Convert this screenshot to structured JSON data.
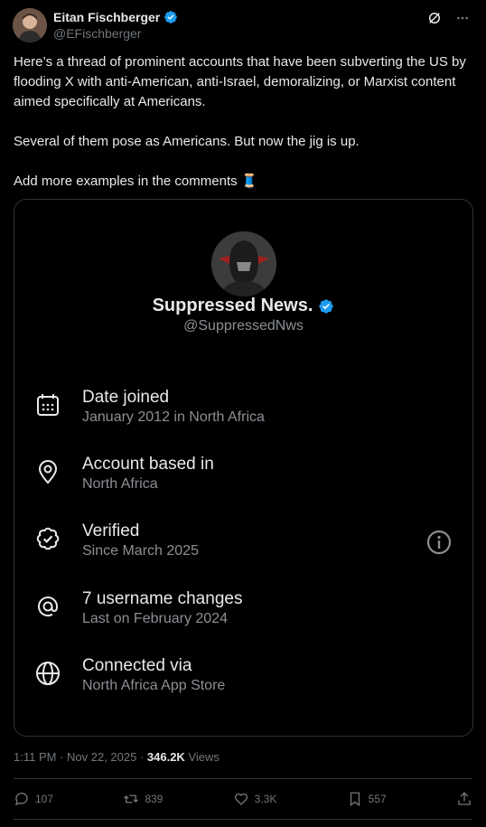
{
  "author": {
    "name": "Eitan Fischberger",
    "handle": "@EFischberger",
    "verified": true
  },
  "header_icons": [
    "grok-icon",
    "more-icon"
  ],
  "tweet": {
    "text": "Here’s a thread of prominent accounts that have been subverting the US by flooding X with anti-American, anti-Israel, demoralizing, or Marxist content aimed specifically at Americans.\n\nSeveral of them pose as Americans. But now the jig is up.\n\nAdd more examples in the comments 🧵"
  },
  "card": {
    "name": "Suppressed News.",
    "handle": "@SuppressedNws",
    "rows": [
      {
        "title": "Date joined",
        "sub": "January 2012 in North Africa",
        "icon": "calendar-icon"
      },
      {
        "title": "Account based in",
        "sub": "North Africa",
        "icon": "location-icon"
      },
      {
        "title": "Verified",
        "sub": "Since March 2025",
        "icon": "verified-icon"
      },
      {
        "title": "7 username changes",
        "sub": "Last on February 2024",
        "icon": "at-icon"
      },
      {
        "title": "Connected via",
        "sub": "North Africa App Store",
        "icon": "globe-icon"
      }
    ]
  },
  "meta": {
    "time": "1:11 PM · Nov 22, 2025 · ",
    "views_count": "346.2K",
    "views_label": " Views"
  },
  "actions": {
    "replies": "107",
    "reposts": "839",
    "likes": "3.3K",
    "bookmarks": "557"
  },
  "colors": {
    "accent": "#1d9bf0",
    "text": "#e7e9ea",
    "muted": "#71767b",
    "border": "#2f3336"
  }
}
